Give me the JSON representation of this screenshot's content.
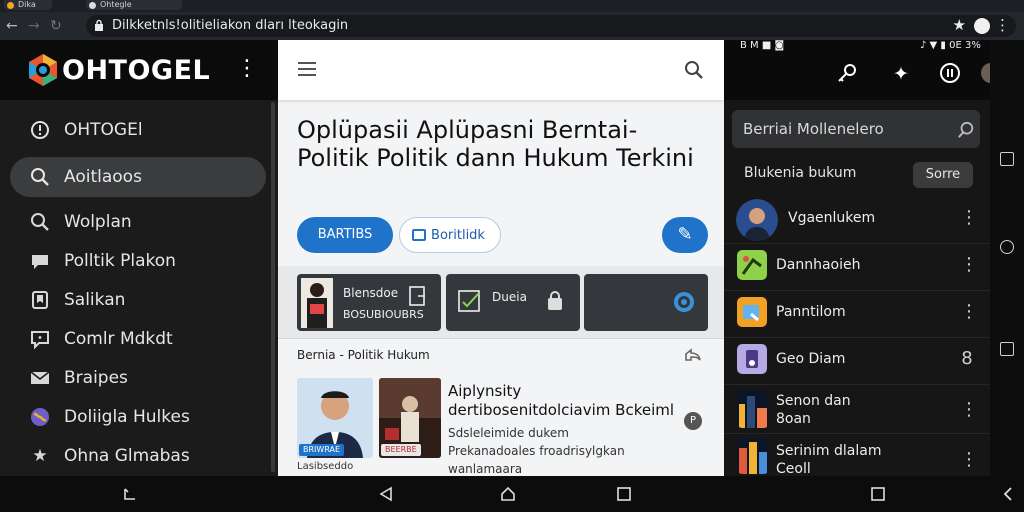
{
  "browser": {
    "tabs": [
      "Dika",
      "Ohtegle"
    ],
    "url": "Dikelsatis Politikan dan Hukum Terbaru",
    "url_display": "Dilkketnls!olitieliakon dları lteokagin"
  },
  "drawer": {
    "brand": "OHTOGEL",
    "items": [
      {
        "icon": "info-icon",
        "label": "OHTOGEl"
      },
      {
        "icon": "search-icon",
        "label": "Aoitlaoos",
        "active": true
      },
      {
        "icon": "search-icon",
        "label": "Wolplan"
      },
      {
        "icon": "chat-icon",
        "label": "Polltik Plakon"
      },
      {
        "icon": "bookmark-icon",
        "label": "Salikan"
      },
      {
        "icon": "comment-icon",
        "label": "Comlr Mdkdt"
      },
      {
        "icon": "mail-icon",
        "label": "Braipes"
      },
      {
        "icon": "globe-icon",
        "label": "Doliigla Hulkes"
      },
      {
        "icon": "star-icon",
        "label": "Ohna Glmabas"
      }
    ]
  },
  "article": {
    "title": "Oplüpasii Aplüpasni Berntai-Politik Politik  dann Hukum Terkini",
    "chip_primary": "BARTIBS",
    "chip_secondary": "Boritlidk",
    "tiles": [
      {
        "title": "Blensdoe",
        "sub": "BOSUBIOUBRS"
      },
      {
        "title": "Dueia",
        "sub": ""
      },
      {
        "title": "",
        "sub": ""
      }
    ],
    "section_title": "Bernia - Politik Hukum",
    "headline": "Aiplynsity dertibosenitdolciavim Bckeiml",
    "subtitle_1": "Sdsleleimide dukem",
    "subtitle_2": "Prekanadoales froadrisylgkan",
    "subtitle_3": "wanlamaara",
    "caption": "Lasibseddo",
    "thumb_tags": [
      "BRIWRAE",
      "BEERBE"
    ],
    "badge": "P"
  },
  "messages": {
    "status_left": "B M ■ ◙",
    "status_right": "♪ ▼ ▮ 0E 3%",
    "search_placeholder": "Berriai Mollenelero",
    "subheader": "Blukenia bukum",
    "subheader_button": "Sorre",
    "rows": [
      {
        "name": "Vgaenlukem",
        "avatar": "person",
        "trail": "⋮"
      },
      {
        "name": "Dannhaoieh",
        "avatar": "green",
        "trail": "⋮"
      },
      {
        "name": "Panntilom",
        "avatar": "orange",
        "trail": "⋮"
      },
      {
        "name": "Geo Diam",
        "avatar": "purple",
        "trail": "8"
      },
      {
        "name": "Senon dan\n8oan",
        "avatar": "city",
        "trail": "⋮"
      },
      {
        "name": "Serinim dlalam\nCeoll",
        "avatar": "city",
        "trail": "⋮"
      }
    ]
  },
  "colors": {
    "accent": "#1f73c9",
    "drawer_bg": "#1b1b1c",
    "page_bg": "#f3f4f6",
    "panel_bg": "#161617"
  }
}
